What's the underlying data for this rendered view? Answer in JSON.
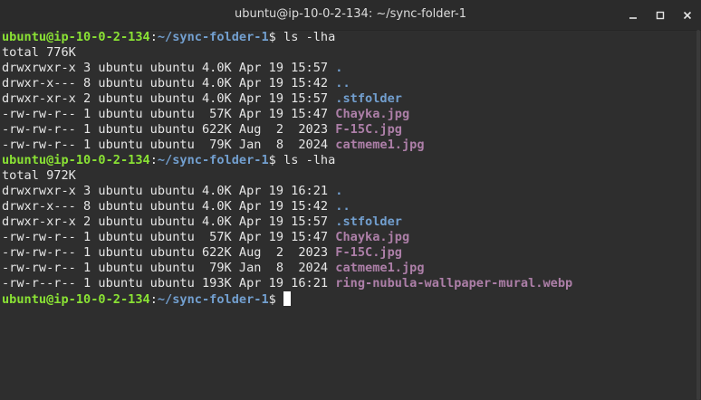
{
  "window": {
    "title": "ubuntu@ip-10-0-2-134: ~/sync-folder-1",
    "controls": [
      "minimize-icon",
      "maximize-icon",
      "close-icon"
    ]
  },
  "prompt": {
    "user_host": "ubuntu@ip-10-0-2-134",
    "colon": ":",
    "path": "~/sync-folder-1",
    "symbol": "$ "
  },
  "colors": {
    "user_host": "#8ae234",
    "path": "#729fcf",
    "image_file": "#ad7fa8",
    "background": "#2e2e2e",
    "text": "#e6e6e6"
  },
  "blocks": [
    {
      "command": "ls -lha",
      "total": "total 776K",
      "rows": [
        {
          "meta": "drwxrwxr-x 3 ubuntu ubuntu 4.0K Apr 19 15:57 ",
          "name": ".",
          "kind": "dir"
        },
        {
          "meta": "drwxr-x--- 8 ubuntu ubuntu 4.0K Apr 19 15:42 ",
          "name": "..",
          "kind": "dir"
        },
        {
          "meta": "drwxr-xr-x 2 ubuntu ubuntu 4.0K Apr 19 15:57 ",
          "name": ".stfolder",
          "kind": "dir"
        },
        {
          "meta": "-rw-rw-r-- 1 ubuntu ubuntu  57K Apr 19 15:47 ",
          "name": "Chayka.jpg",
          "kind": "img"
        },
        {
          "meta": "-rw-rw-r-- 1 ubuntu ubuntu 622K Aug  2  2023 ",
          "name": "F-15C.jpg",
          "kind": "img"
        },
        {
          "meta": "-rw-rw-r-- 1 ubuntu ubuntu  79K Jan  8  2024 ",
          "name": "catmeme1.jpg",
          "kind": "img"
        }
      ]
    },
    {
      "command": "ls -lha",
      "total": "total 972K",
      "rows": [
        {
          "meta": "drwxrwxr-x 3 ubuntu ubuntu 4.0K Apr 19 16:21 ",
          "name": ".",
          "kind": "dir"
        },
        {
          "meta": "drwxr-x--- 8 ubuntu ubuntu 4.0K Apr 19 15:42 ",
          "name": "..",
          "kind": "dir"
        },
        {
          "meta": "drwxr-xr-x 2 ubuntu ubuntu 4.0K Apr 19 15:57 ",
          "name": ".stfolder",
          "kind": "dir"
        },
        {
          "meta": "-rw-rw-r-- 1 ubuntu ubuntu  57K Apr 19 15:47 ",
          "name": "Chayka.jpg",
          "kind": "img"
        },
        {
          "meta": "-rw-rw-r-- 1 ubuntu ubuntu 622K Aug  2  2023 ",
          "name": "F-15C.jpg",
          "kind": "img"
        },
        {
          "meta": "-rw-rw-r-- 1 ubuntu ubuntu  79K Jan  8  2024 ",
          "name": "catmeme1.jpg",
          "kind": "img"
        },
        {
          "meta": "-rw-r--r-- 1 ubuntu ubuntu 193K Apr 19 16:21 ",
          "name": "ring-nubula-wallpaper-mural.webp",
          "kind": "img"
        }
      ]
    }
  ]
}
